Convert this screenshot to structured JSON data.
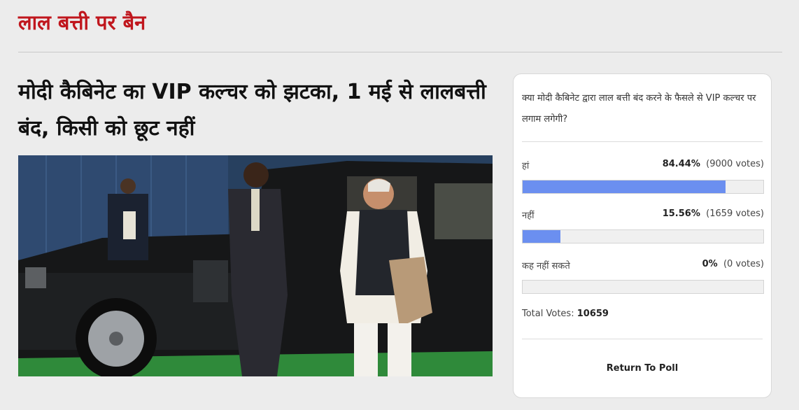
{
  "section": {
    "title": "लाल बत्ती पर बैन"
  },
  "article": {
    "headline": "मोदी कैबिनेट का VIP कल्चर को झटका, 1 मई से लालबत्ती बंद, किसी को छूट नहीं"
  },
  "poll": {
    "question": "क्या मोदी कैबिनेट द्वारा लाल बत्ती बंद करने के फैसले से VIP कल्चर पर लगाम लगेगी?",
    "options": [
      {
        "label": "हां",
        "percent_text": "84.44%",
        "votes_text": "(9000 votes)",
        "fraction": 0.8444
      },
      {
        "label": "नहीं",
        "percent_text": "15.56%",
        "votes_text": "(1659 votes)",
        "fraction": 0.1556
      },
      {
        "label": "कह नहीं सकते",
        "percent_text": "0%",
        "votes_text": "(0 votes)",
        "fraction": 0
      }
    ],
    "total_label": "Total Votes:",
    "total_value": "10659",
    "return_label": "Return To Poll",
    "bar_color": "#6b8ff0"
  },
  "colors": {
    "accent": "#c0161d"
  }
}
